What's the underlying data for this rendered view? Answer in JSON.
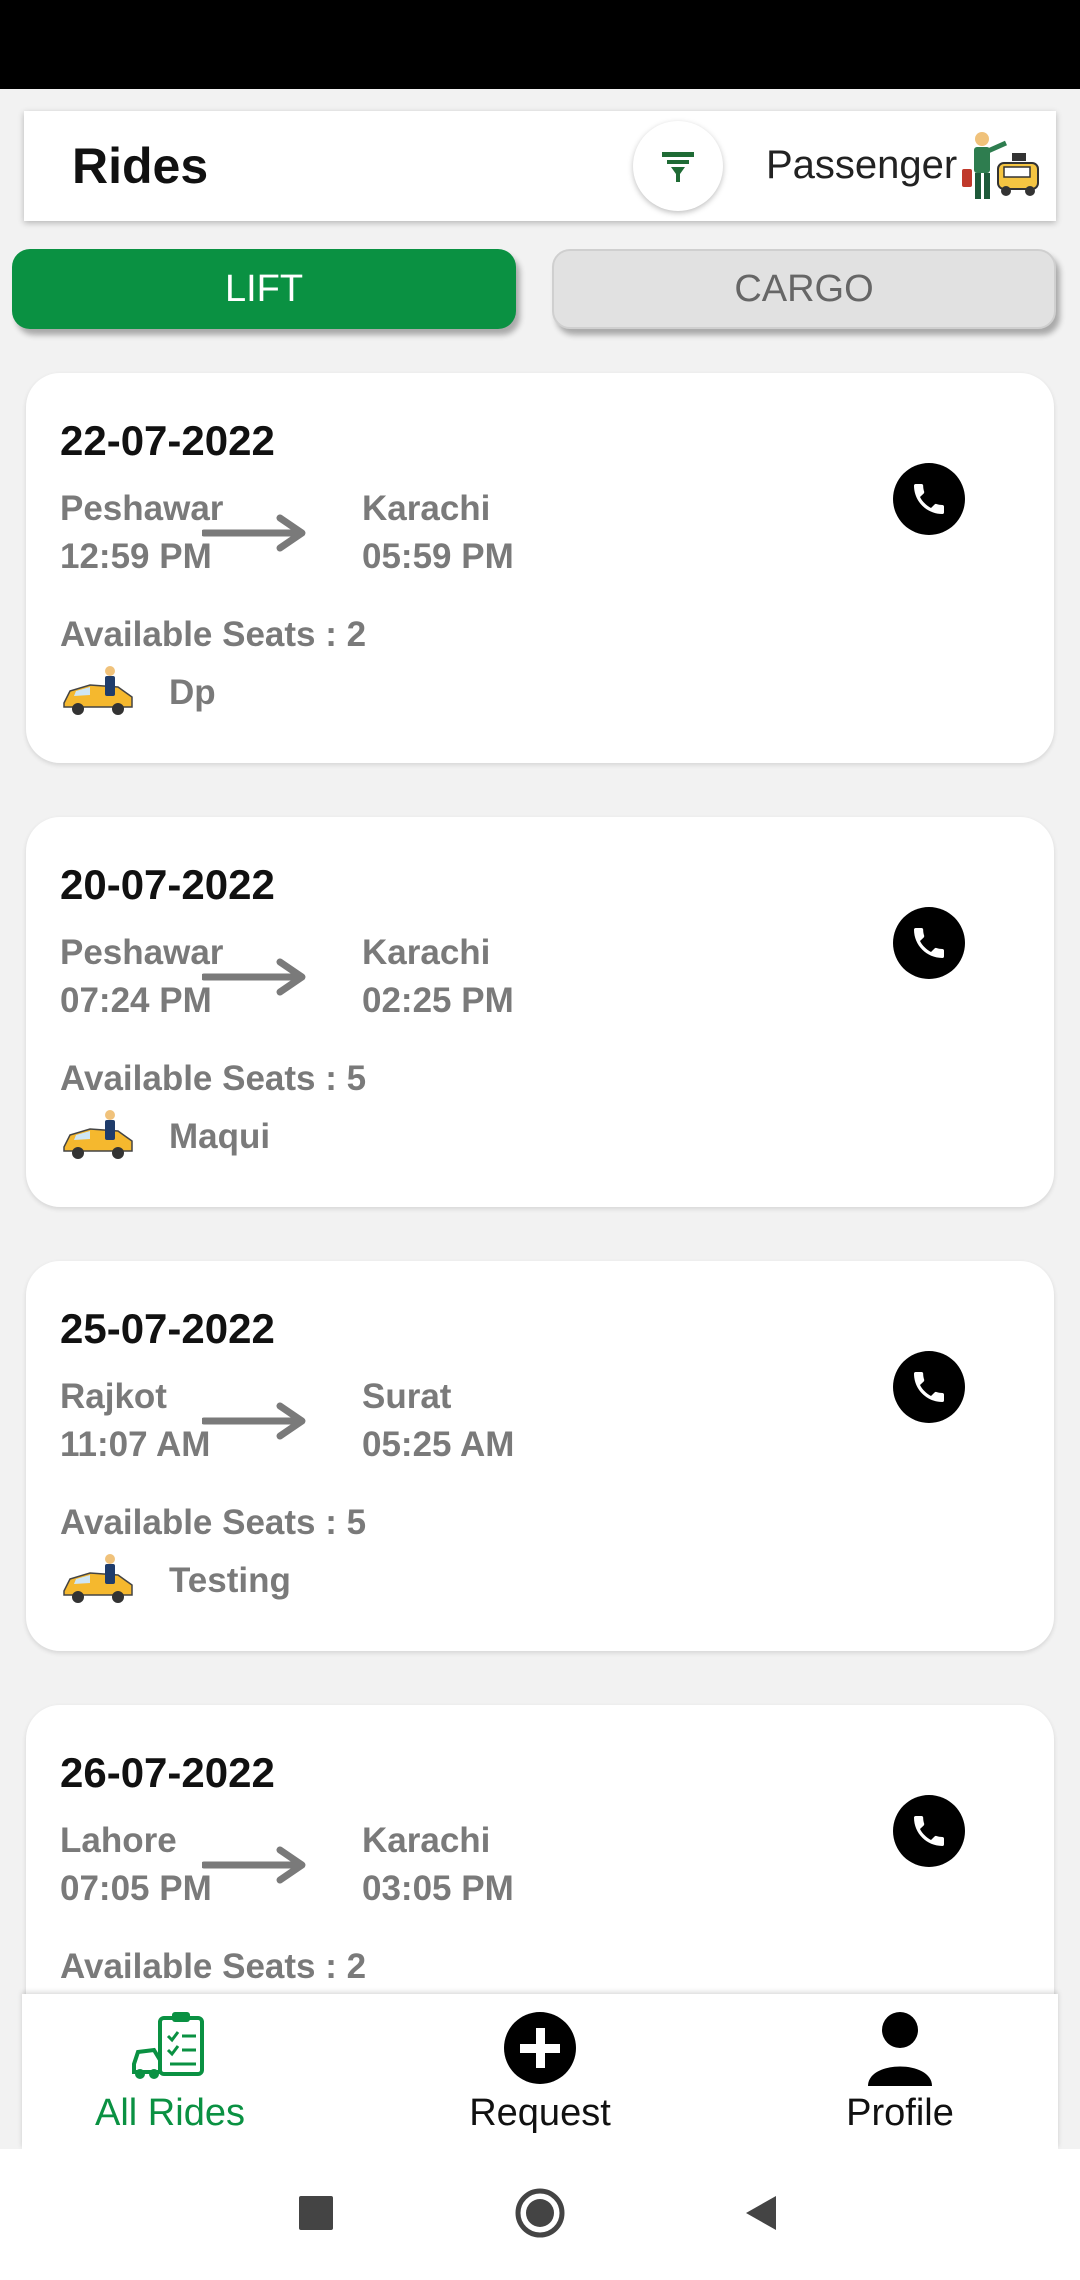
{
  "header": {
    "title": "Rides",
    "mode_label": "Passenger"
  },
  "tabs": [
    {
      "label": "LIFT",
      "active": true
    },
    {
      "label": "CARGO",
      "active": false
    }
  ],
  "rides": [
    {
      "date": "22-07-2022",
      "from_city": "Peshawar",
      "from_time": "12:59 PM",
      "to_city": "Karachi",
      "to_time": "05:59 PM",
      "seats": "Available Seats : 2",
      "driver": "Dp"
    },
    {
      "date": "20-07-2022",
      "from_city": "Peshawar",
      "from_time": "07:24 PM",
      "to_city": "Karachi",
      "to_time": "02:25 PM",
      "seats": "Available Seats : 5",
      "driver": "Maqui"
    },
    {
      "date": "25-07-2022",
      "from_city": "Rajkot",
      "from_time": "11:07 AM",
      "to_city": "Surat",
      "to_time": "05:25 AM",
      "seats": "Available Seats : 5",
      "driver": "Testing"
    },
    {
      "date": "26-07-2022",
      "from_city": "Lahore",
      "from_time": "07:05 PM",
      "to_city": "Karachi",
      "to_time": "03:05 PM",
      "seats": "Available Seats : 2",
      "driver": ""
    }
  ],
  "bottom_nav": [
    {
      "label": "All Rides",
      "icon": "all-rides-icon",
      "active": true
    },
    {
      "label": "Request",
      "icon": "plus-circle-icon",
      "active": false
    },
    {
      "label": "Profile",
      "icon": "person-icon",
      "active": false
    }
  ],
  "colors": {
    "accent": "#0a9142",
    "muted_text": "#7a7a7a",
    "background": "#f2f2f2"
  }
}
